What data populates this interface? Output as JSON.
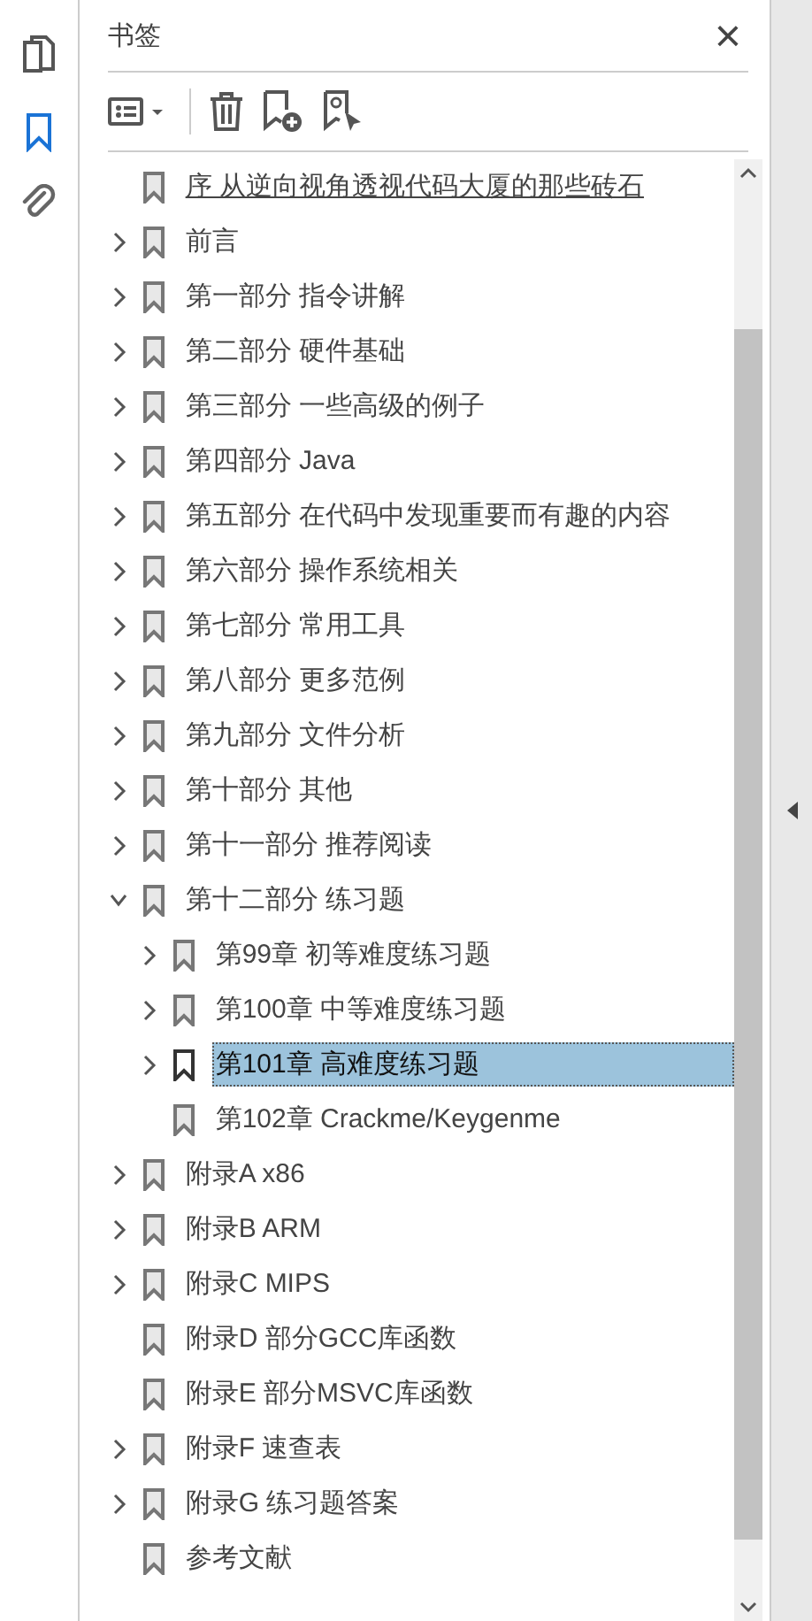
{
  "panel": {
    "title": "书签",
    "close": "×"
  },
  "tree": [
    {
      "label": "序 从逆向视角透视代码大厦的那些砖石",
      "selected": false,
      "hovered": true
    },
    {
      "label": "前言",
      "expanded": false,
      "selected": false,
      "hovered": false
    },
    {
      "label": "第一部分 指令讲解",
      "expanded": false,
      "selected": false,
      "hovered": false
    },
    {
      "label": "第二部分 硬件基础",
      "expanded": false,
      "selected": false,
      "hovered": false
    },
    {
      "label": "第三部分 一些高级的例子",
      "expanded": false,
      "selected": false,
      "hovered": false
    },
    {
      "label": "第四部分 Java",
      "expanded": false,
      "selected": false,
      "hovered": false
    },
    {
      "label": "第五部分 在代码中发现重要而有趣的内容",
      "expanded": false,
      "selected": false,
      "hovered": false
    },
    {
      "label": "第六部分 操作系统相关",
      "expanded": false,
      "selected": false,
      "hovered": false
    },
    {
      "label": "第七部分 常用工具",
      "expanded": false,
      "selected": false,
      "hovered": false
    },
    {
      "label": "第八部分 更多范例",
      "expanded": false,
      "selected": false,
      "hovered": false
    },
    {
      "label": "第九部分 文件分析",
      "expanded": false,
      "selected": false,
      "hovered": false
    },
    {
      "label": "第十部分 其他",
      "expanded": false,
      "selected": false,
      "hovered": false
    },
    {
      "label": "第十一部分 推荐阅读",
      "expanded": false,
      "selected": false,
      "hovered": false
    },
    {
      "label": "第十二部分 练习题",
      "expanded": true,
      "selected": false,
      "hovered": false,
      "children": [
        {
          "label": "第99章 初等难度练习题",
          "expanded": false,
          "selected": false,
          "hovered": false
        },
        {
          "label": "第100章 中等难度练习题",
          "expanded": false,
          "selected": false,
          "hovered": false
        },
        {
          "label": "第101章 高难度练习题",
          "expanded": false,
          "selected": true,
          "hovered": false
        },
        {
          "label": "第102章 Crackme/Keygenme",
          "selected": false,
          "hovered": false
        }
      ]
    },
    {
      "label": "附录A x86",
      "expanded": false,
      "selected": false,
      "hovered": false
    },
    {
      "label": "附录B ARM",
      "expanded": false,
      "selected": false,
      "hovered": false
    },
    {
      "label": "附录C MIPS",
      "expanded": false,
      "selected": false,
      "hovered": false
    },
    {
      "label": "附录D 部分GCC库函数",
      "selected": false,
      "hovered": false
    },
    {
      "label": "附录E 部分MSVC库函数",
      "selected": false,
      "hovered": false
    },
    {
      "label": "附录F 速查表",
      "expanded": false,
      "selected": false,
      "hovered": false
    },
    {
      "label": "附录G 练习题答案",
      "expanded": false,
      "selected": false,
      "hovered": false
    },
    {
      "label": "参考文献",
      "selected": false,
      "hovered": false
    }
  ]
}
